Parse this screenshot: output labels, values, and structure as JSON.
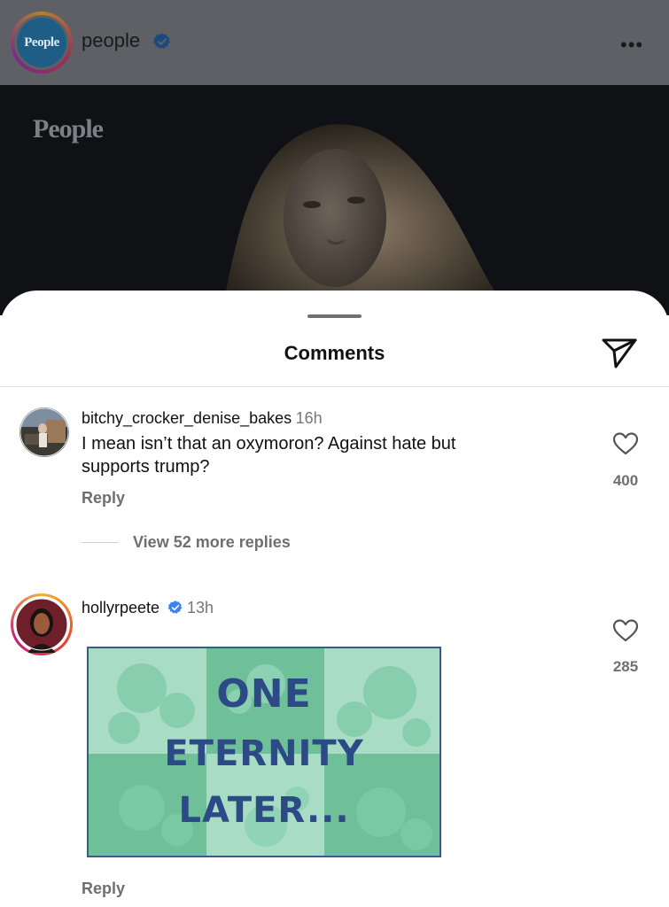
{
  "post": {
    "username": "people",
    "avatar_text": "People",
    "image_brand": "People",
    "more_icon": "more-horizontal-icon"
  },
  "sheet": {
    "title": "Comments",
    "share_icon": "send-icon"
  },
  "comments": [
    {
      "username": "bitchy_crocker_denise_bakes",
      "time": "16h",
      "text_line1": "I mean isn’t that an oxymoron? Against hate but",
      "text_line2": "supports trump?",
      "reply_label": "Reply",
      "likes": "400",
      "view_replies": "View 52 more replies"
    },
    {
      "username": "hollyrpeete",
      "verified": true,
      "time": "13h",
      "gif_lines": [
        "ONE",
        "ETERNITY",
        "LATER..."
      ],
      "reply_label": "Reply",
      "likes": "285"
    }
  ],
  "colors": {
    "verified": "#3b82f6",
    "gif_bg_light": "#9fd8bf",
    "gif_bg_dark": "#6fbf99",
    "gif_text": "#2c4a86"
  }
}
